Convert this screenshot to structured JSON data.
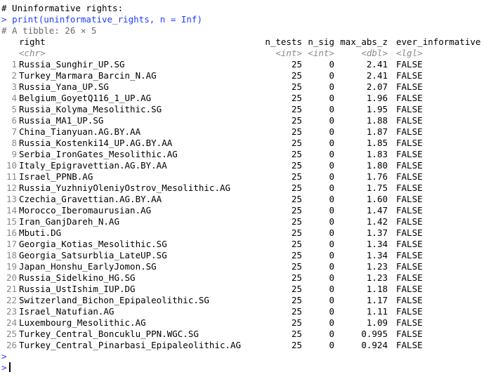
{
  "console": {
    "comment": "# Uninformative rights:",
    "prompt": ">",
    "command": "print(uninformative_rights, n = Inf)",
    "tibble_meta": "# A tibble: 26 × 5",
    "empty_prompt": ">",
    "active_prompt": ">"
  },
  "table": {
    "columns": [
      {
        "name": "right",
        "type": "<chr>"
      },
      {
        "name": "n_tests",
        "type": "<int>"
      },
      {
        "name": "n_sig",
        "type": "<int>"
      },
      {
        "name": "max_abs_z",
        "type": "<dbl>"
      },
      {
        "name": "ever_informative",
        "type": "<lgl>"
      }
    ],
    "rows": [
      {
        "idx": "1",
        "right": "Russia_Sunghir_UP.SG",
        "n_tests": "25",
        "n_sig": "0",
        "max_abs_z": "2.41",
        "ever": "FALSE"
      },
      {
        "idx": "2",
        "right": "Turkey_Marmara_Barcin_N.AG",
        "n_tests": "25",
        "n_sig": "0",
        "max_abs_z": "2.41",
        "ever": "FALSE"
      },
      {
        "idx": "3",
        "right": "Russia_Yana_UP.SG",
        "n_tests": "25",
        "n_sig": "0",
        "max_abs_z": "2.07",
        "ever": "FALSE"
      },
      {
        "idx": "4",
        "right": "Belgium_GoyetQ116_1_UP.AG",
        "n_tests": "25",
        "n_sig": "0",
        "max_abs_z": "1.96",
        "ever": "FALSE"
      },
      {
        "idx": "5",
        "right": "Russia_Kolyma_Mesolithic.SG",
        "n_tests": "25",
        "n_sig": "0",
        "max_abs_z": "1.95",
        "ever": "FALSE"
      },
      {
        "idx": "6",
        "right": "Russia_MA1_UP.SG",
        "n_tests": "25",
        "n_sig": "0",
        "max_abs_z": "1.88",
        "ever": "FALSE"
      },
      {
        "idx": "7",
        "right": "China_Tianyuan.AG.BY.AA",
        "n_tests": "25",
        "n_sig": "0",
        "max_abs_z": "1.87",
        "ever": "FALSE"
      },
      {
        "idx": "8",
        "right": "Russia_Kostenki14_UP.AG.BY.AA",
        "n_tests": "25",
        "n_sig": "0",
        "max_abs_z": "1.85",
        "ever": "FALSE"
      },
      {
        "idx": "9",
        "right": "Serbia_IronGates_Mesolithic.AG",
        "n_tests": "25",
        "n_sig": "0",
        "max_abs_z": "1.83",
        "ever": "FALSE"
      },
      {
        "idx": "10",
        "right": "Italy_Epigravettian.AG.BY.AA",
        "n_tests": "25",
        "n_sig": "0",
        "max_abs_z": "1.80",
        "ever": "FALSE"
      },
      {
        "idx": "11",
        "right": "Israel_PPNB.AG",
        "n_tests": "25",
        "n_sig": "0",
        "max_abs_z": "1.76",
        "ever": "FALSE"
      },
      {
        "idx": "12",
        "right": "Russia_YuzhniyOleniyOstrov_Mesolithic.AG",
        "n_tests": "25",
        "n_sig": "0",
        "max_abs_z": "1.75",
        "ever": "FALSE"
      },
      {
        "idx": "13",
        "right": "Czechia_Gravettian.AG.BY.AA",
        "n_tests": "25",
        "n_sig": "0",
        "max_abs_z": "1.60",
        "ever": "FALSE"
      },
      {
        "idx": "14",
        "right": "Morocco_Iberomaurusian.AG",
        "n_tests": "25",
        "n_sig": "0",
        "max_abs_z": "1.47",
        "ever": "FALSE"
      },
      {
        "idx": "15",
        "right": "Iran_GanjDareh_N.AG",
        "n_tests": "25",
        "n_sig": "0",
        "max_abs_z": "1.42",
        "ever": "FALSE"
      },
      {
        "idx": "16",
        "right": "Mbuti.DG",
        "n_tests": "25",
        "n_sig": "0",
        "max_abs_z": "1.37",
        "ever": "FALSE"
      },
      {
        "idx": "17",
        "right": "Georgia_Kotias_Mesolithic.SG",
        "n_tests": "25",
        "n_sig": "0",
        "max_abs_z": "1.34",
        "ever": "FALSE"
      },
      {
        "idx": "18",
        "right": "Georgia_Satsurblia_LateUP.SG",
        "n_tests": "25",
        "n_sig": "0",
        "max_abs_z": "1.34",
        "ever": "FALSE"
      },
      {
        "idx": "19",
        "right": "Japan_Honshu_EarlyJomon.SG",
        "n_tests": "25",
        "n_sig": "0",
        "max_abs_z": "1.23",
        "ever": "FALSE"
      },
      {
        "idx": "20",
        "right": "Russia_Sidelkino_HG.SG",
        "n_tests": "25",
        "n_sig": "0",
        "max_abs_z": "1.23",
        "ever": "FALSE"
      },
      {
        "idx": "21",
        "right": "Russia_UstIshim_IUP.DG",
        "n_tests": "25",
        "n_sig": "0",
        "max_abs_z": "1.18",
        "ever": "FALSE"
      },
      {
        "idx": "22",
        "right": "Switzerland_Bichon_Epipaleolithic.SG",
        "n_tests": "25",
        "n_sig": "0",
        "max_abs_z": "1.17",
        "ever": "FALSE"
      },
      {
        "idx": "23",
        "right": "Israel_Natufian.AG",
        "n_tests": "25",
        "n_sig": "0",
        "max_abs_z": "1.11",
        "ever": "FALSE"
      },
      {
        "idx": "24",
        "right": "Luxembourg_Mesolithic.AG",
        "n_tests": "25",
        "n_sig": "0",
        "max_abs_z": "1.09",
        "ever": "FALSE"
      },
      {
        "idx": "25",
        "right": "Turkey_Central_Boncuklu_PPN.WGC.SG",
        "n_tests": "25",
        "n_sig": "0",
        "max_abs_z": "0.995",
        "ever": "FALSE"
      },
      {
        "idx": "26",
        "right": "Turkey_Central_Pinarbasi_Epipaleolithic.AG",
        "n_tests": "25",
        "n_sig": "0",
        "max_abs_z": "0.924",
        "ever": "FALSE"
      }
    ]
  },
  "colors": {
    "prompt": "#1e3cff",
    "meta": "#6b6b6b",
    "type_annotation": "#8a8a8a",
    "background": "#ffffff"
  }
}
